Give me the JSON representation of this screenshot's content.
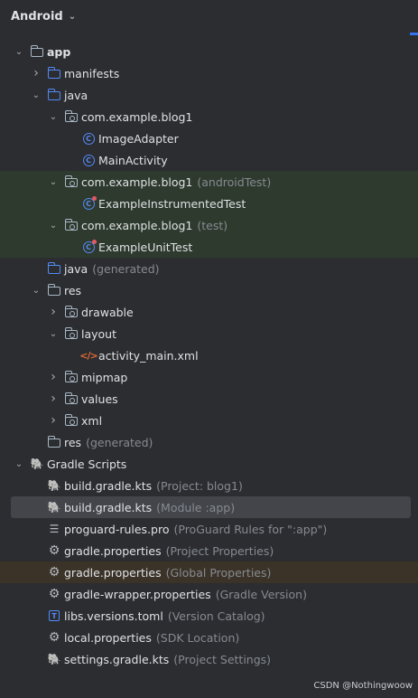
{
  "header": {
    "title": "Android"
  },
  "tree": [
    {
      "depth": 0,
      "arrow": "open",
      "icon": "module-folder",
      "label": "app",
      "bold": true
    },
    {
      "depth": 1,
      "arrow": "closed",
      "icon": "folder",
      "label": "manifests"
    },
    {
      "depth": 1,
      "arrow": "open",
      "icon": "folder",
      "label": "java"
    },
    {
      "depth": 2,
      "arrow": "open",
      "icon": "package",
      "label": "com.example.blog1"
    },
    {
      "depth": 3,
      "arrow": null,
      "icon": "class",
      "label": "ImageAdapter"
    },
    {
      "depth": 3,
      "arrow": null,
      "icon": "class",
      "label": "MainActivity"
    },
    {
      "depth": 2,
      "arrow": "open",
      "icon": "package",
      "label": "com.example.blog1",
      "sub": "(androidTest)",
      "bg": "green"
    },
    {
      "depth": 3,
      "arrow": null,
      "icon": "test-class",
      "label": "ExampleInstrumentedTest",
      "bg": "green"
    },
    {
      "depth": 2,
      "arrow": "open",
      "icon": "package",
      "label": "com.example.blog1",
      "sub": "(test)",
      "bg": "green"
    },
    {
      "depth": 3,
      "arrow": null,
      "icon": "test-class",
      "label": "ExampleUnitTest",
      "bg": "green"
    },
    {
      "depth": 1,
      "arrow": null,
      "icon": "generated-folder",
      "label": "java",
      "sub": "(generated)"
    },
    {
      "depth": 1,
      "arrow": "open",
      "icon": "res-folder",
      "label": "res"
    },
    {
      "depth": 2,
      "arrow": "closed",
      "icon": "package",
      "label": "drawable"
    },
    {
      "depth": 2,
      "arrow": "open",
      "icon": "package",
      "label": "layout"
    },
    {
      "depth": 3,
      "arrow": null,
      "icon": "xml-file",
      "label": "activity_main.xml"
    },
    {
      "depth": 2,
      "arrow": "closed",
      "icon": "package",
      "label": "mipmap"
    },
    {
      "depth": 2,
      "arrow": "closed",
      "icon": "package",
      "label": "values"
    },
    {
      "depth": 2,
      "arrow": "closed",
      "icon": "package",
      "label": "xml"
    },
    {
      "depth": 1,
      "arrow": null,
      "icon": "res-folder",
      "label": "res",
      "sub": "(generated)"
    },
    {
      "depth": 0,
      "arrow": "open",
      "icon": "gradle",
      "label": "Gradle Scripts"
    },
    {
      "depth": 1,
      "arrow": null,
      "icon": "gradle",
      "label": "build.gradle.kts",
      "sub": "(Project: blog1)"
    },
    {
      "depth": 1,
      "arrow": null,
      "icon": "gradle",
      "label": "build.gradle.kts",
      "sub": "(Module :app)",
      "bg": "selected"
    },
    {
      "depth": 1,
      "arrow": null,
      "icon": "text-file",
      "label": "proguard-rules.pro",
      "sub": "(ProGuard Rules for \":app\")"
    },
    {
      "depth": 1,
      "arrow": null,
      "icon": "settings",
      "label": "gradle.properties",
      "sub": "(Project Properties)"
    },
    {
      "depth": 1,
      "arrow": null,
      "icon": "settings",
      "label": "gradle.properties",
      "sub": "(Global Properties)",
      "bg": "brown"
    },
    {
      "depth": 1,
      "arrow": null,
      "icon": "settings",
      "label": "gradle-wrapper.properties",
      "sub": "(Gradle Version)"
    },
    {
      "depth": 1,
      "arrow": null,
      "icon": "toml",
      "label": "libs.versions.toml",
      "sub": "(Version Catalog)"
    },
    {
      "depth": 1,
      "arrow": null,
      "icon": "settings",
      "label": "local.properties",
      "sub": "(SDK Location)"
    },
    {
      "depth": 1,
      "arrow": null,
      "icon": "gradle",
      "label": "settings.gradle.kts",
      "sub": "(Project Settings)"
    }
  ],
  "watermark": "CSDN @Nothingwoow",
  "colors": {
    "background": "#2b2d30",
    "accent": "#548af7",
    "test_bg": "#2e3a2e",
    "selected_bg": "#43454a"
  }
}
